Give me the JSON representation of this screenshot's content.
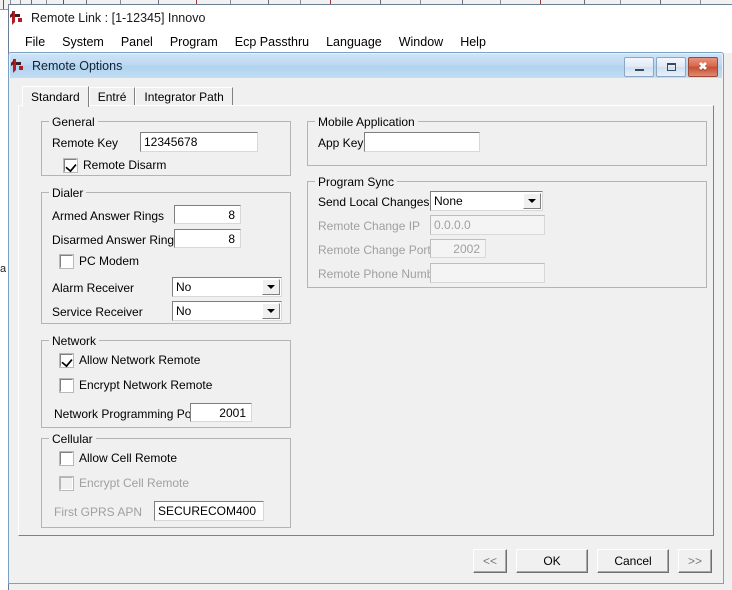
{
  "app": {
    "icon": "remote-link-logo-icon",
    "title": "Remote Link : [1-12345] Innovo",
    "menu": [
      "File",
      "System",
      "Panel",
      "Program",
      "Ecp Passthru",
      "Language",
      "Window",
      "Help"
    ],
    "background_sliver_text": "at"
  },
  "dialog": {
    "icon": "remote-link-logo-icon",
    "title": "Remote Options",
    "window_buttons": {
      "minimize": "minimize-icon",
      "maximize": "maximize-icon",
      "close": "close-icon",
      "close_glyph": "✖"
    },
    "tabs": [
      {
        "label": "Standard",
        "active": true
      },
      {
        "label": "Entré",
        "active": false
      },
      {
        "label": "Integrator Path",
        "active": false
      }
    ],
    "groups": {
      "general": {
        "legend": "General",
        "remote_key_label": "Remote Key",
        "remote_key_value": "12345678",
        "remote_disarm_label": "Remote Disarm",
        "remote_disarm_checked": true
      },
      "dialer": {
        "legend": "Dialer",
        "armed_answer_rings_label": "Armed Answer Rings",
        "armed_answer_rings_value": "8",
        "disarmed_answer_rings_label": "Disarmed Answer Rings",
        "disarmed_answer_rings_value": "8",
        "pc_modem_label": "PC Modem",
        "pc_modem_checked": false,
        "alarm_receiver_label": "Alarm Receiver",
        "alarm_receiver_value": "No",
        "service_receiver_label": "Service Receiver",
        "service_receiver_value": "No"
      },
      "network": {
        "legend": "Network",
        "allow_network_remote_label": "Allow Network Remote",
        "allow_network_remote_checked": true,
        "encrypt_network_remote_label": "Encrypt Network Remote",
        "encrypt_network_remote_checked": false,
        "network_programming_port_label": "Network Programming Port",
        "network_programming_port_value": "2001"
      },
      "cellular": {
        "legend": "Cellular",
        "allow_cell_remote_label": "Allow Cell Remote",
        "allow_cell_remote_checked": false,
        "encrypt_cell_remote_label": "Encrypt Cell Remote",
        "encrypt_cell_remote_checked": false,
        "first_gprs_apn_label": "First GPRS APN",
        "first_gprs_apn_value": "SECURECOM400"
      },
      "mobile_application": {
        "legend": "Mobile Application",
        "app_key_label": "App Key",
        "app_key_value": "",
        "app_key_placeholder": ""
      },
      "program_sync": {
        "legend": "Program Sync",
        "send_local_changes_label": "Send Local Changes",
        "send_local_changes_value": "None",
        "send_local_changes_options": [
          "None"
        ],
        "remote_change_ip_label": "Remote Change IP",
        "remote_change_ip_value": "0.0.0.0",
        "remote_change_port_label": "Remote Change Port",
        "remote_change_port_value": "2002",
        "remote_phone_number_label": "Remote Phone Number",
        "remote_phone_number_value": ""
      }
    },
    "buttons": {
      "prev": "<<",
      "ok": "OK",
      "cancel": "Cancel",
      "next": ">>"
    }
  },
  "colors": {
    "dialog_title_gradient_start": "#cfe3f6",
    "dialog_title_gradient_end": "#aed2ef",
    "dialog_border": "#7ba1c4",
    "face": "#f0f0f0",
    "field_bg": "#ffffff",
    "disabled_text": "#a0a0a0",
    "close_button": "#c44f34",
    "logo_red": "#b01c23"
  }
}
